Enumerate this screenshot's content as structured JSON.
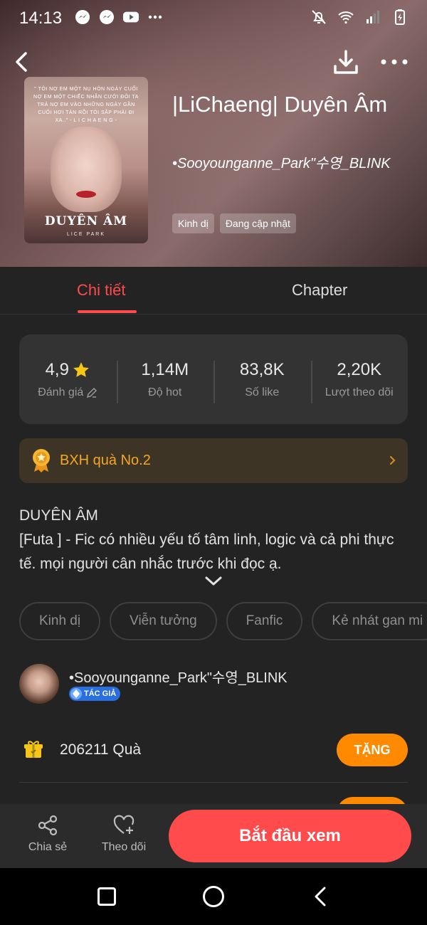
{
  "status_bar": {
    "time": "14:13",
    "left_icons": [
      "messenger-icon",
      "messenger-icon",
      "youtube-icon",
      "more-dots-icon"
    ],
    "right_icons": [
      "bell-off-icon",
      "wifi-icon",
      "signal-icon",
      "battery-icon"
    ]
  },
  "header": {
    "cover": {
      "quote": "\" TÔI NỢ EM MỘT NỤ HÔN NGÀY CUỐI NỢ EM MỘT CHIẾC NHẪN CƯỚI ĐÔI TA TRẢ NỢ EM VÀO NHỮNG NGÀY GẦN CUỐI HƠI TÀN RỒI TÔI SẮP PHẢI ĐI XA..\" - L I C H A E N G -",
      "title": "DUYÊN ÂM",
      "author": "LICE PARK"
    },
    "title": "|LiChaeng| Duyên Âm",
    "author": "•Sooyounganne_Park\"수영_BLINK",
    "tags": [
      "Kinh dị",
      "Đang cập nhật"
    ]
  },
  "tabs": [
    {
      "label": "Chi tiết",
      "active": true
    },
    {
      "label": "Chapter",
      "active": false
    }
  ],
  "stats": [
    {
      "value": "4,9",
      "label": "Đánh giá"
    },
    {
      "value": "1,14M",
      "label": "Độ hot"
    },
    {
      "value": "83,8K",
      "label": "Số like"
    },
    {
      "value": "2,20K",
      "label": "Lượt theo dõi"
    }
  ],
  "ranking": {
    "label": "BXH quà No.2"
  },
  "description": {
    "line1": "DUYÊN ÂM",
    "line2": "[Futa ] - Fic có nhiều yếu tố tâm linh, logic và cả phi thực tế. mọi người cân nhắc trước khi đọc ạ."
  },
  "genres": [
    "Kinh dị",
    "Viễn tưởng",
    "Fanfic",
    "Kẻ nhát gan mi"
  ],
  "author_row": {
    "name": "•Sooyounganne_Park\"수영_BLINK",
    "badge": "TÁC GIẢ"
  },
  "gift": {
    "count": "206211",
    "unit": "Quà",
    "button": "TẶNG"
  },
  "action_bar": {
    "share": "Chia sẻ",
    "follow": "Theo dõi",
    "start": "Bắt đầu xem"
  },
  "colors": {
    "accent_red": "#ff4b4b",
    "accent_orange": "#ff8a00",
    "rank_gold": "#f5a623",
    "star_yellow": "#f5c518"
  }
}
